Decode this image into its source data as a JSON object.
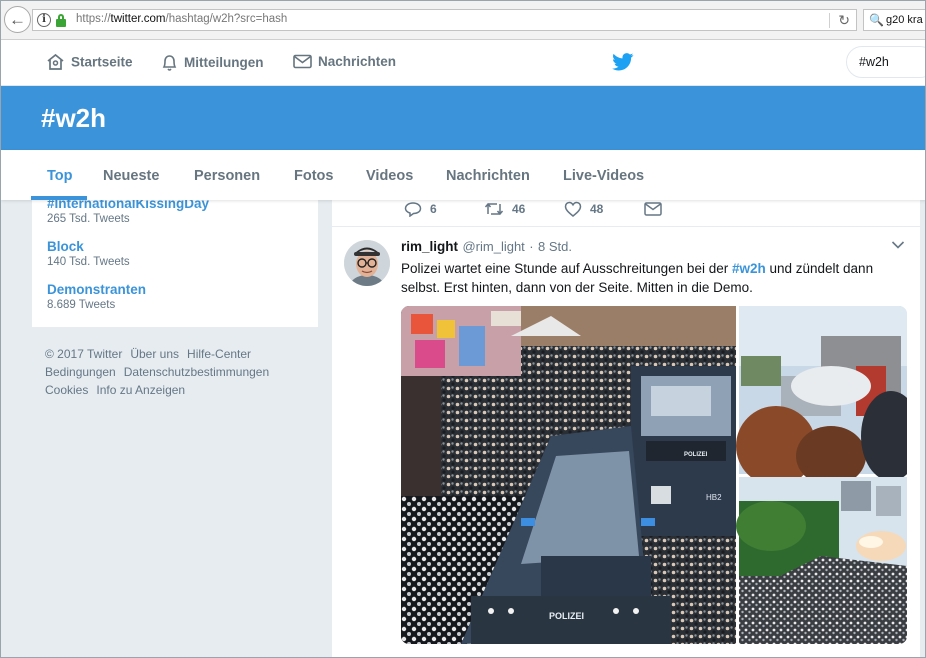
{
  "browser": {
    "url_prefix": "https://",
    "url_host": "twitter.com",
    "url_path": "/hashtag/w2h?src=hash",
    "search_text": "g20 kra"
  },
  "nav": {
    "home": "Startseite",
    "notifications": "Mitteilungen",
    "messages": "Nachrichten",
    "search_value": "#w2h",
    "brand_color": "#1da1f2"
  },
  "banner": {
    "hashtag": "#w2h",
    "color": "#3b94d9"
  },
  "tabs": [
    "Top",
    "Neueste",
    "Personen",
    "Fotos",
    "Videos",
    "Nachrichten",
    "Live-Videos"
  ],
  "trends": [
    {
      "name": "#InternationalKissingDay",
      "count": "265 Tsd. Tweets"
    },
    {
      "name": "Block",
      "count": "140 Tsd. Tweets"
    },
    {
      "name": "Demonstranten",
      "count": "8.689 Tweets"
    }
  ],
  "footer": {
    "line1": [
      "© 2017 Twitter",
      "Über uns",
      "Hilfe-Center"
    ],
    "line2": [
      "Bedingungen",
      "Datenschutzbestimmungen"
    ],
    "line3": [
      "Cookies",
      "Info zu Anzeigen"
    ]
  },
  "prev_tweet_actions": {
    "replies": "6",
    "retweets": "46",
    "likes": "48"
  },
  "tweet": {
    "name": "rim_light",
    "handle": "@rim_light",
    "dot": "·",
    "time": "8 Std.",
    "text_before": "Polizei wartet eine Stunde auf Ausschreitungen bei der ",
    "hashtag": "#w2h",
    "text_after": " und zündelt dann selbst. Erst hinten, dann von der Seite. Mitten in die Demo.",
    "photo_label_vehicle": "POLIZEI",
    "photo_label_vehicle2": "POLIZEI",
    "photo_plate": "HB2"
  }
}
